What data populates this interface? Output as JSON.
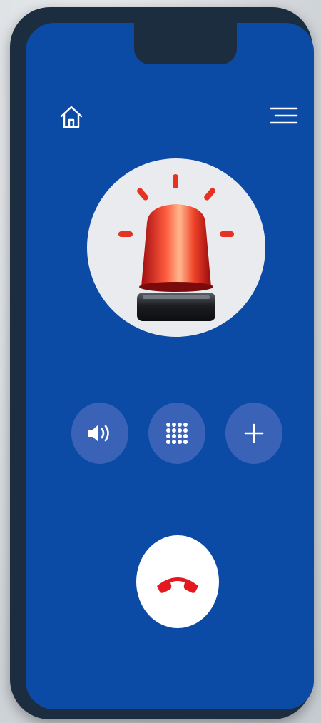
{
  "screen": {
    "background_color": "#0b4ba6",
    "frame_color": "#1b2d3f"
  },
  "top_bar": {
    "home_icon": "home-icon",
    "menu_icon": "hamburger-menu-icon"
  },
  "alarm": {
    "icon": "emergency-siren-icon",
    "beacon_color": "#e53222",
    "circle_color": "#e9ebee"
  },
  "call_controls": [
    {
      "name": "speaker",
      "icon": "speaker-volume-icon"
    },
    {
      "name": "keypad",
      "icon": "dialpad-icon"
    },
    {
      "name": "add-call",
      "icon": "plus-icon"
    }
  ],
  "end_call": {
    "icon": "hang-up-phone-icon",
    "color": "#e3191f"
  }
}
